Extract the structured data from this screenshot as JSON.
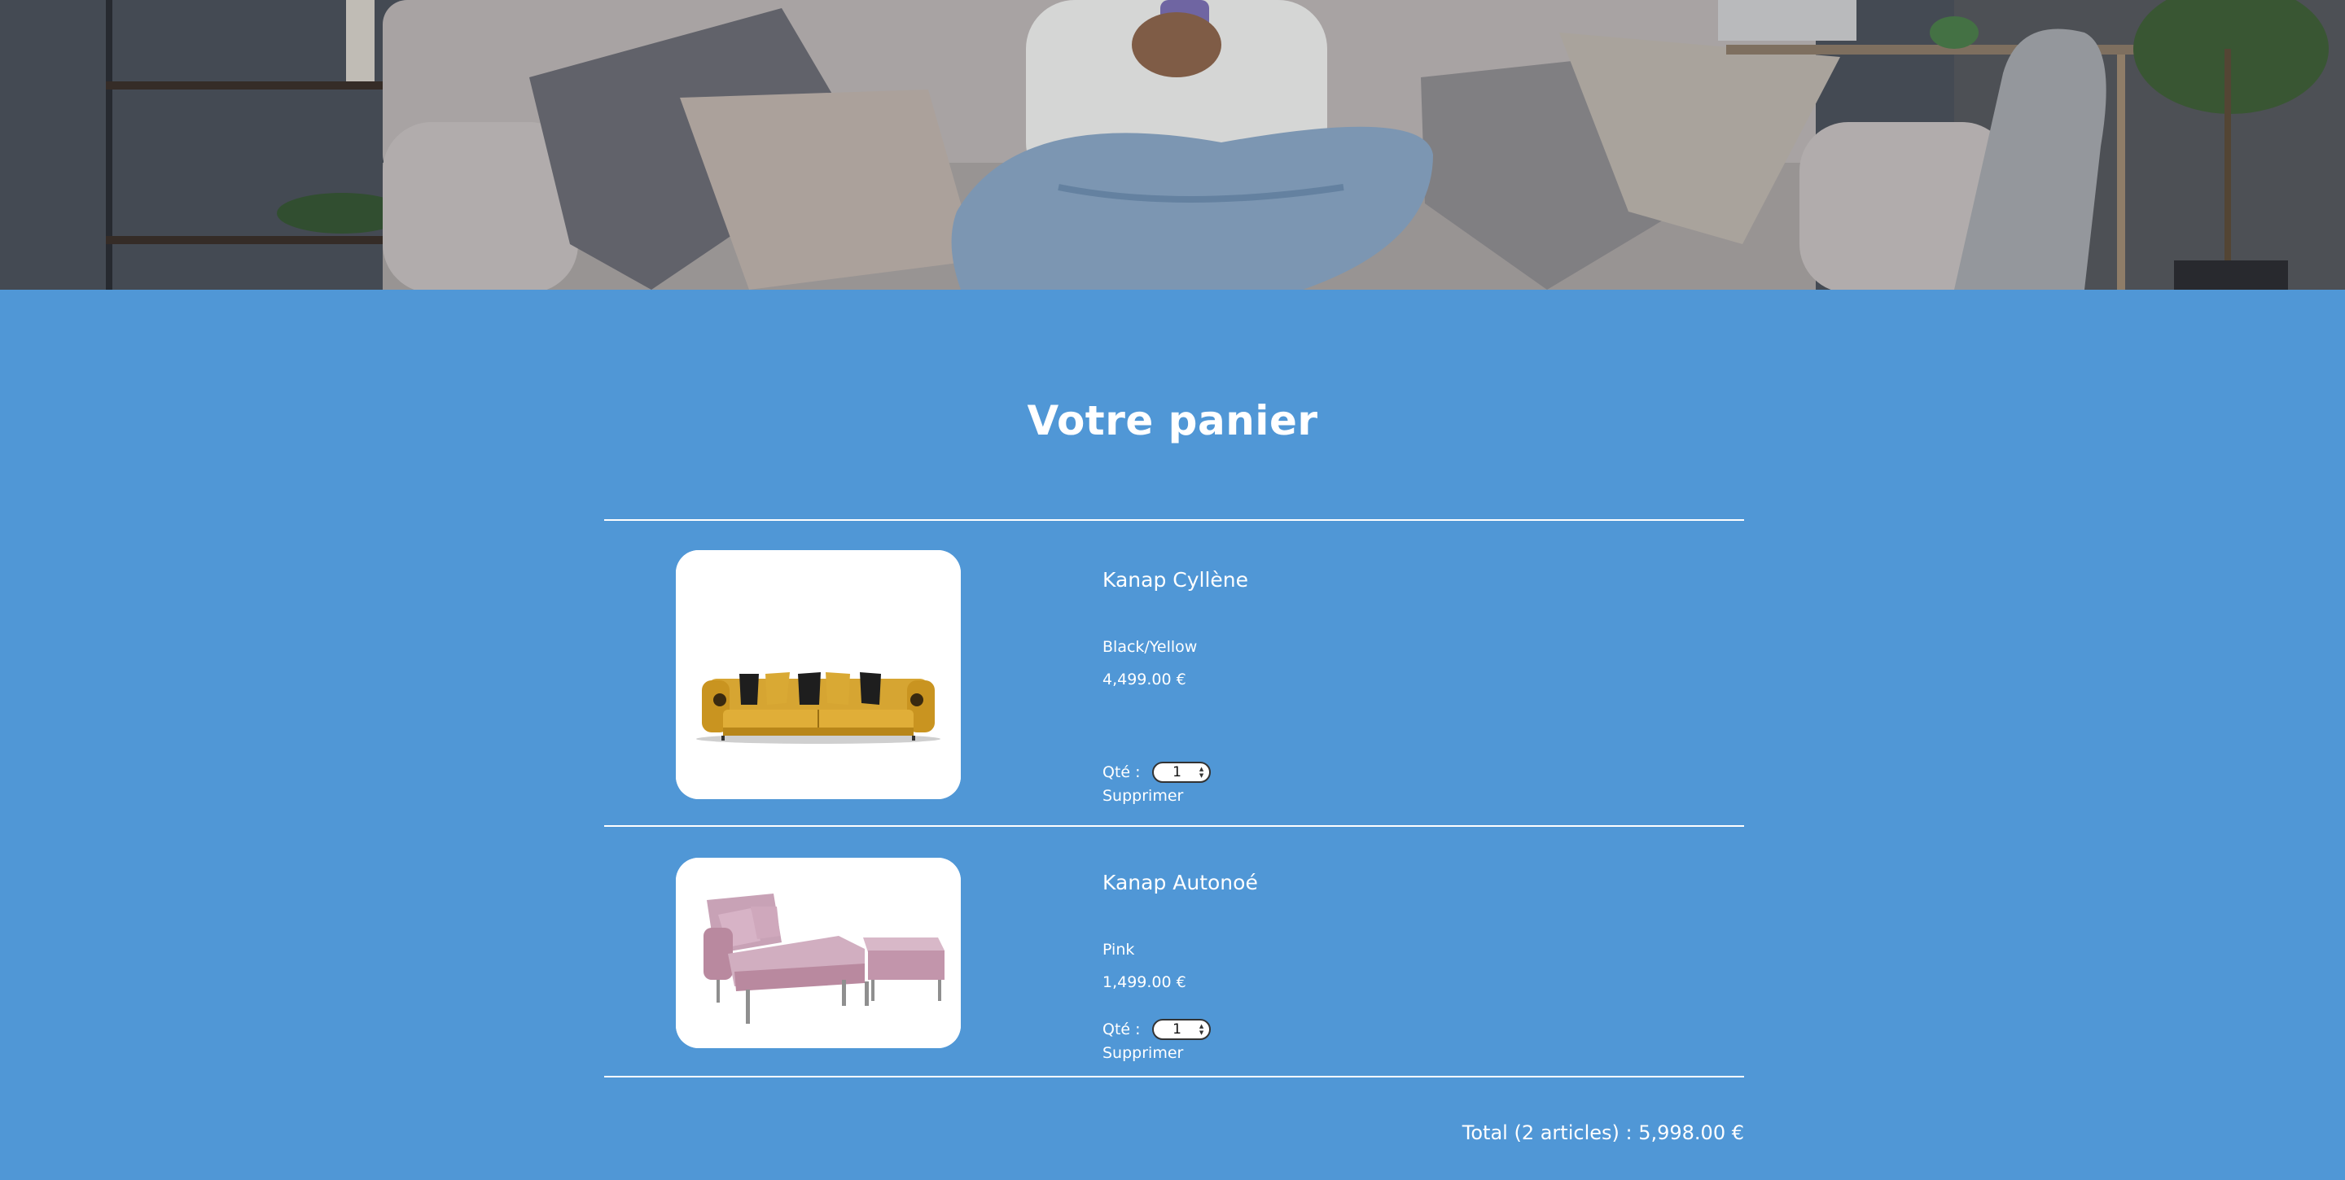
{
  "hero": {
    "image": "woman-on-sofa-with-phone-photo"
  },
  "cart": {
    "title": "Votre panier",
    "items": [
      {
        "name": "Kanap Cyllène",
        "color": "Black/Yellow",
        "price": "4,499.00 €",
        "qty_label": "Qté :",
        "qty_value": "1",
        "delete_label": "Supprimer",
        "image": "yellow-sofa-with-black-cushions"
      },
      {
        "name": "Kanap Autonoé",
        "color": "Pink",
        "price": "1,499.00 €",
        "qty_label": "Qté :",
        "qty_value": "1",
        "delete_label": "Supprimer",
        "image": "pink-chaise-sofa-with-ottoman"
      }
    ],
    "total_prefix": "Total (",
    "total_count": "2",
    "total_middle": " articles) : ",
    "total_price": "5,998.00",
    "total_suffix": " €"
  },
  "colors": {
    "background": "#5097d6",
    "text": "#ffffff"
  }
}
